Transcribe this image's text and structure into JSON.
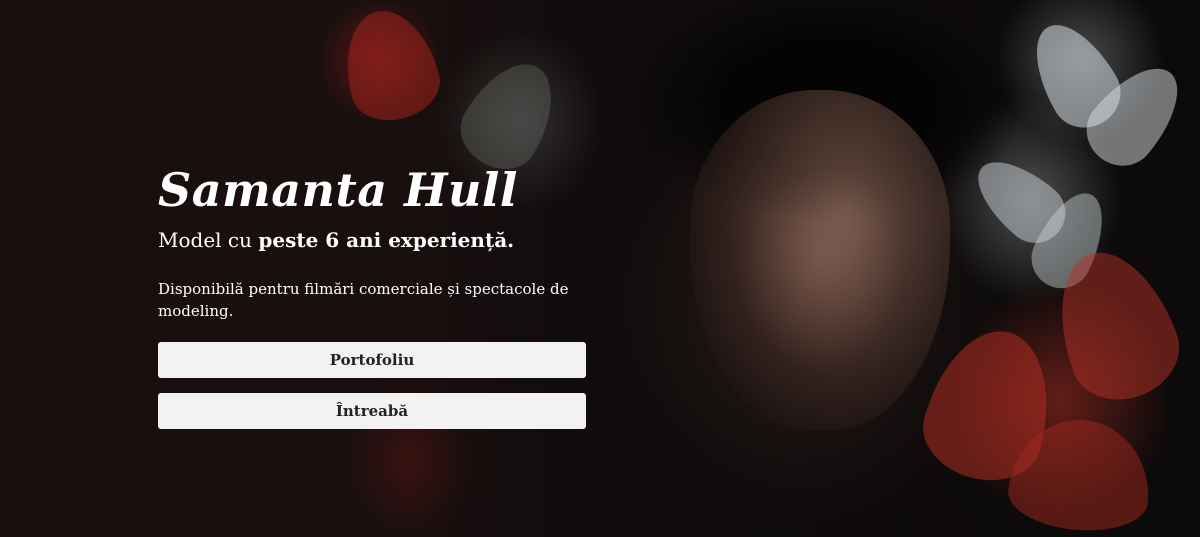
{
  "hero": {
    "title": "Samanta Hull",
    "subtitle_prefix": "Model cu ",
    "subtitle_bold": "peste 6 ani experiență.",
    "description": "Disponibilă pentru filmări comerciale și spectacole de modeling.",
    "buttons": {
      "portfolio": "Portofoliu",
      "ask": "Întreabă"
    }
  },
  "colors": {
    "background": "#0d0a0a",
    "text": "#ffffff",
    "button_bg": "#f2f2f2",
    "button_text": "#222222",
    "flower_red": "#b8322a",
    "flower_white": "#d9dfe2"
  }
}
